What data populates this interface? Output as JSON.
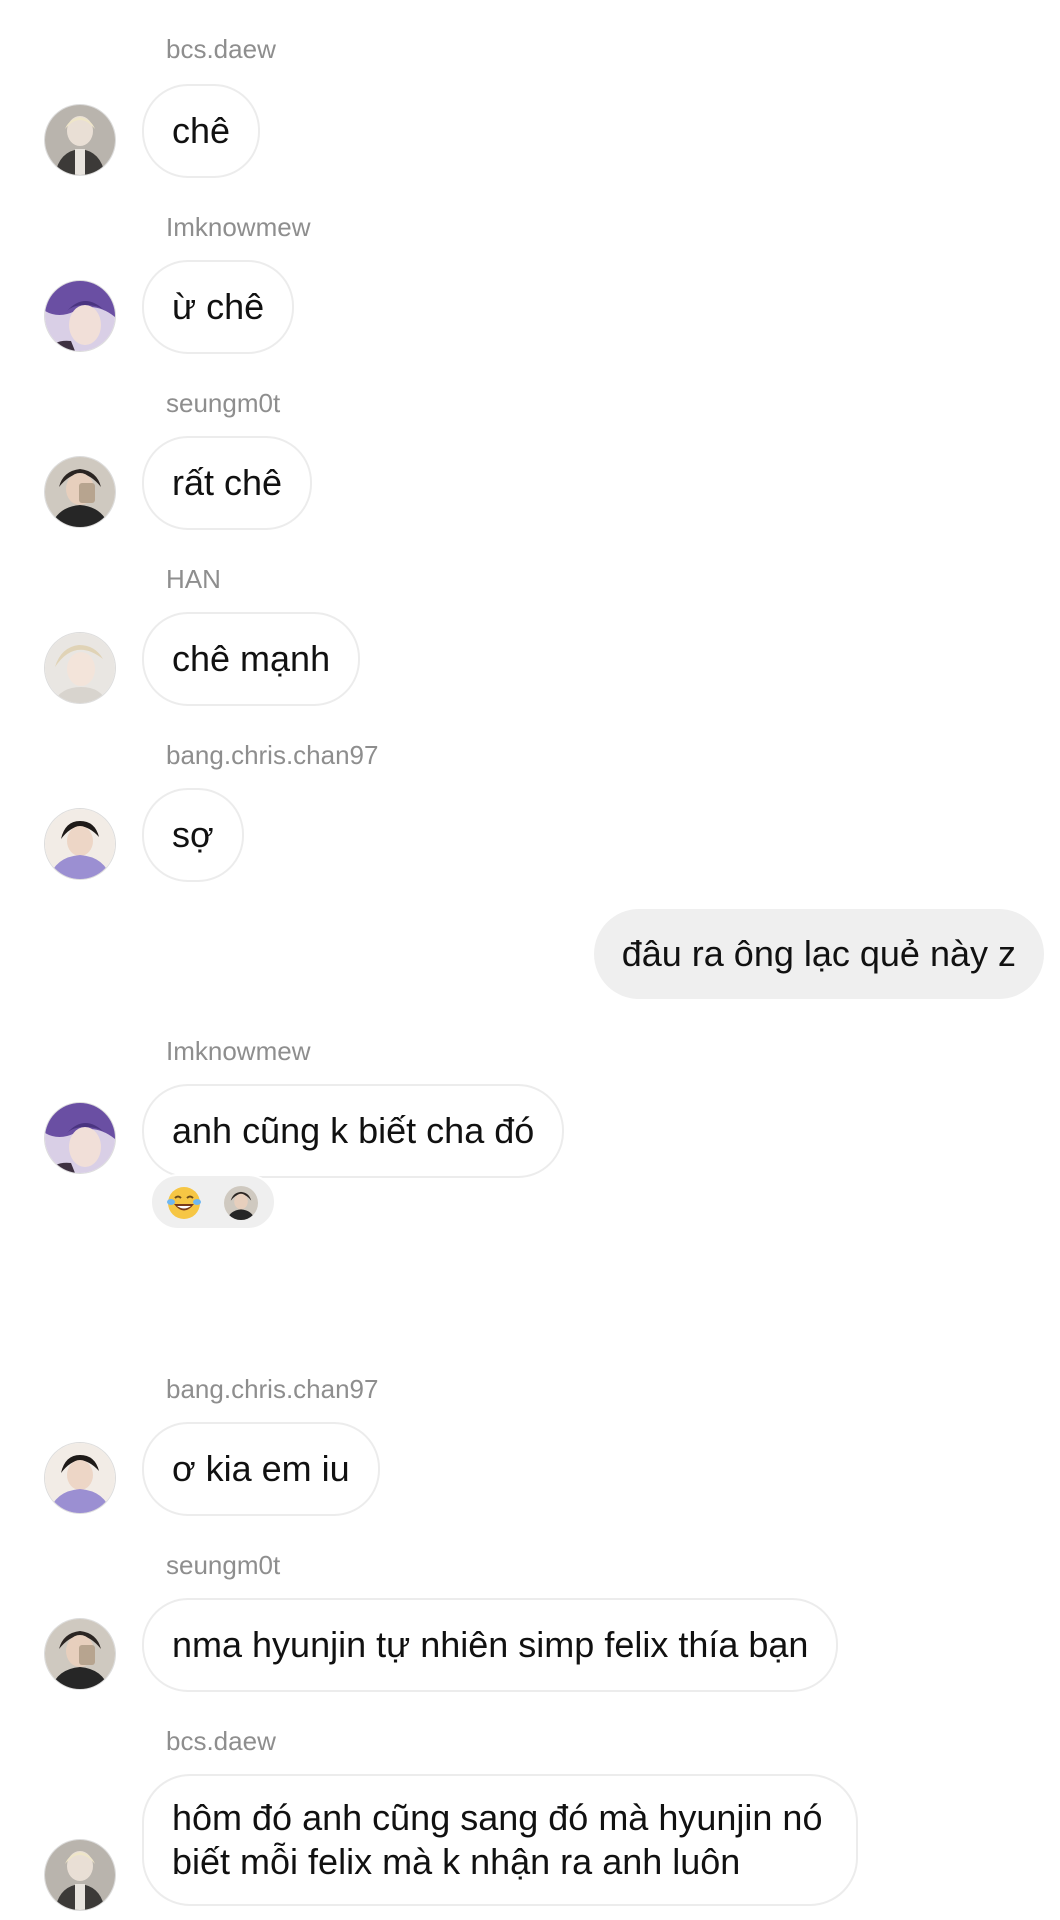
{
  "messages": [
    {
      "user": "bcs.daew",
      "text": "chê"
    },
    {
      "user": "Imknowmew",
      "text": "ừ chê"
    },
    {
      "user": "seungm0t",
      "text": "rất chê"
    },
    {
      "user": "HAN",
      "text": "chê mạnh"
    },
    {
      "user": "bang.chris.chan97",
      "text": "sợ"
    },
    {
      "user": "",
      "text": "đâu ra ông lạc quẻ này z"
    },
    {
      "user": "Imknowmew",
      "text": "anh cũng k biết cha đó"
    },
    {
      "user": "bang.chris.chan97",
      "text": "ơ kia em iu"
    },
    {
      "user": "seungm0t",
      "text": "nma hyunjin tự nhiên simp felix thía bạn"
    },
    {
      "user": "bcs.daew",
      "text_line1": "hôm đó anh cũng sang đó mà hyunjin nó",
      "text_line2": "biết mỗi felix mà k nhận ra anh luôn"
    }
  ],
  "reaction": {
    "emoji": "laughing-tears-emoji",
    "reactor": "seungm0t"
  },
  "colors": {
    "incoming_bubble_border": "#ececec",
    "outgoing_bubble_bg": "#efefef",
    "username_text": "#8e8e8e",
    "message_text": "#111111"
  }
}
